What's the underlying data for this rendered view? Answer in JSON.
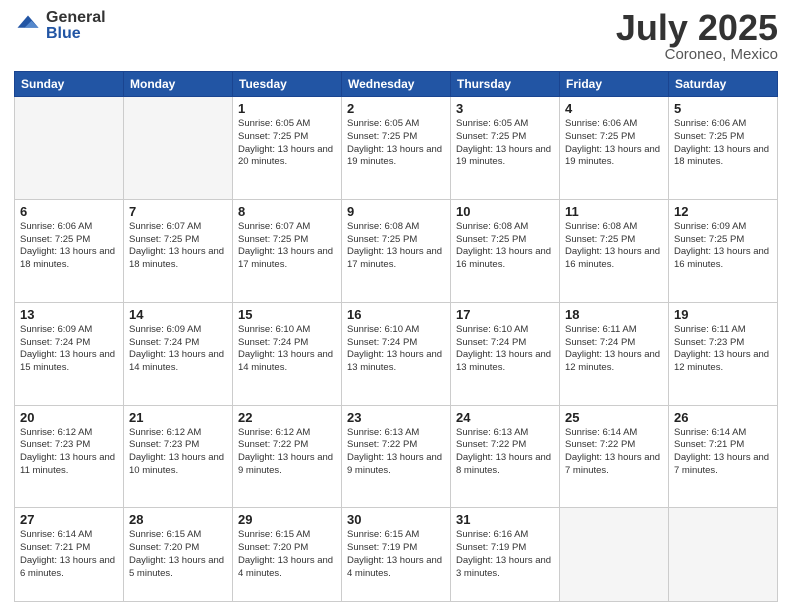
{
  "header": {
    "logo_general": "General",
    "logo_blue": "Blue",
    "title": "July 2025",
    "location": "Coroneo, Mexico"
  },
  "days_of_week": [
    "Sunday",
    "Monday",
    "Tuesday",
    "Wednesday",
    "Thursday",
    "Friday",
    "Saturday"
  ],
  "weeks": [
    [
      {
        "day": "",
        "info": "",
        "empty": true
      },
      {
        "day": "",
        "info": "",
        "empty": true
      },
      {
        "day": "1",
        "info": "Sunrise: 6:05 AM\nSunset: 7:25 PM\nDaylight: 13 hours and 20 minutes."
      },
      {
        "day": "2",
        "info": "Sunrise: 6:05 AM\nSunset: 7:25 PM\nDaylight: 13 hours and 19 minutes."
      },
      {
        "day": "3",
        "info": "Sunrise: 6:05 AM\nSunset: 7:25 PM\nDaylight: 13 hours and 19 minutes."
      },
      {
        "day": "4",
        "info": "Sunrise: 6:06 AM\nSunset: 7:25 PM\nDaylight: 13 hours and 19 minutes."
      },
      {
        "day": "5",
        "info": "Sunrise: 6:06 AM\nSunset: 7:25 PM\nDaylight: 13 hours and 18 minutes."
      }
    ],
    [
      {
        "day": "6",
        "info": "Sunrise: 6:06 AM\nSunset: 7:25 PM\nDaylight: 13 hours and 18 minutes."
      },
      {
        "day": "7",
        "info": "Sunrise: 6:07 AM\nSunset: 7:25 PM\nDaylight: 13 hours and 18 minutes."
      },
      {
        "day": "8",
        "info": "Sunrise: 6:07 AM\nSunset: 7:25 PM\nDaylight: 13 hours and 17 minutes."
      },
      {
        "day": "9",
        "info": "Sunrise: 6:08 AM\nSunset: 7:25 PM\nDaylight: 13 hours and 17 minutes."
      },
      {
        "day": "10",
        "info": "Sunrise: 6:08 AM\nSunset: 7:25 PM\nDaylight: 13 hours and 16 minutes."
      },
      {
        "day": "11",
        "info": "Sunrise: 6:08 AM\nSunset: 7:25 PM\nDaylight: 13 hours and 16 minutes."
      },
      {
        "day": "12",
        "info": "Sunrise: 6:09 AM\nSunset: 7:25 PM\nDaylight: 13 hours and 16 minutes."
      }
    ],
    [
      {
        "day": "13",
        "info": "Sunrise: 6:09 AM\nSunset: 7:24 PM\nDaylight: 13 hours and 15 minutes."
      },
      {
        "day": "14",
        "info": "Sunrise: 6:09 AM\nSunset: 7:24 PM\nDaylight: 13 hours and 14 minutes."
      },
      {
        "day": "15",
        "info": "Sunrise: 6:10 AM\nSunset: 7:24 PM\nDaylight: 13 hours and 14 minutes."
      },
      {
        "day": "16",
        "info": "Sunrise: 6:10 AM\nSunset: 7:24 PM\nDaylight: 13 hours and 13 minutes."
      },
      {
        "day": "17",
        "info": "Sunrise: 6:10 AM\nSunset: 7:24 PM\nDaylight: 13 hours and 13 minutes."
      },
      {
        "day": "18",
        "info": "Sunrise: 6:11 AM\nSunset: 7:24 PM\nDaylight: 13 hours and 12 minutes."
      },
      {
        "day": "19",
        "info": "Sunrise: 6:11 AM\nSunset: 7:23 PM\nDaylight: 13 hours and 12 minutes."
      }
    ],
    [
      {
        "day": "20",
        "info": "Sunrise: 6:12 AM\nSunset: 7:23 PM\nDaylight: 13 hours and 11 minutes."
      },
      {
        "day": "21",
        "info": "Sunrise: 6:12 AM\nSunset: 7:23 PM\nDaylight: 13 hours and 10 minutes."
      },
      {
        "day": "22",
        "info": "Sunrise: 6:12 AM\nSunset: 7:22 PM\nDaylight: 13 hours and 9 minutes."
      },
      {
        "day": "23",
        "info": "Sunrise: 6:13 AM\nSunset: 7:22 PM\nDaylight: 13 hours and 9 minutes."
      },
      {
        "day": "24",
        "info": "Sunrise: 6:13 AM\nSunset: 7:22 PM\nDaylight: 13 hours and 8 minutes."
      },
      {
        "day": "25",
        "info": "Sunrise: 6:14 AM\nSunset: 7:22 PM\nDaylight: 13 hours and 7 minutes."
      },
      {
        "day": "26",
        "info": "Sunrise: 6:14 AM\nSunset: 7:21 PM\nDaylight: 13 hours and 7 minutes."
      }
    ],
    [
      {
        "day": "27",
        "info": "Sunrise: 6:14 AM\nSunset: 7:21 PM\nDaylight: 13 hours and 6 minutes."
      },
      {
        "day": "28",
        "info": "Sunrise: 6:15 AM\nSunset: 7:20 PM\nDaylight: 13 hours and 5 minutes."
      },
      {
        "day": "29",
        "info": "Sunrise: 6:15 AM\nSunset: 7:20 PM\nDaylight: 13 hours and 4 minutes."
      },
      {
        "day": "30",
        "info": "Sunrise: 6:15 AM\nSunset: 7:19 PM\nDaylight: 13 hours and 4 minutes."
      },
      {
        "day": "31",
        "info": "Sunrise: 6:16 AM\nSunset: 7:19 PM\nDaylight: 13 hours and 3 minutes."
      },
      {
        "day": "",
        "info": "",
        "empty": true
      },
      {
        "day": "",
        "info": "",
        "empty": true
      }
    ]
  ]
}
